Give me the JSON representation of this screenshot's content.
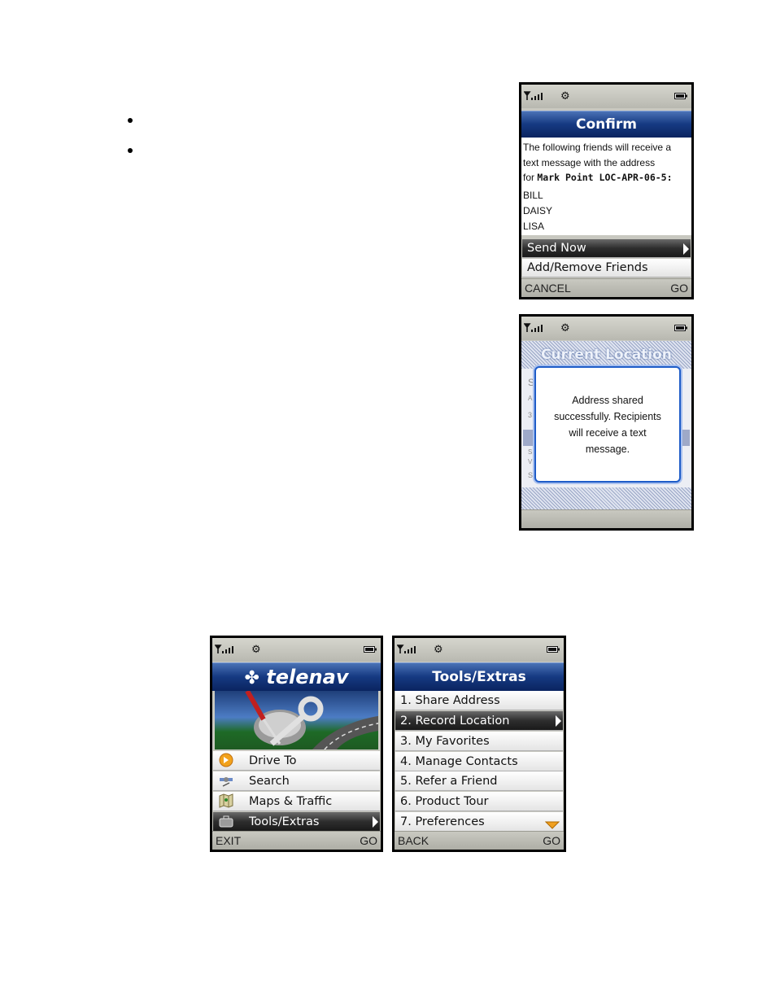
{
  "phone_confirm": {
    "title": "Confirm",
    "message_lines": [
      "The following friends will receive a",
      "text message with the address"
    ],
    "for_prefix": "for",
    "address_name": "Mark Point LOC-APR-06-5:",
    "recipients": [
      "BILL",
      "DAISY",
      "LISA"
    ],
    "options": [
      "Send Now",
      "Add/Remove Friends"
    ],
    "softkey_left": "CANCEL",
    "softkey_right": "GO"
  },
  "phone_current_location": {
    "title": "Current Location",
    "dialog_lines": [
      "Address shared",
      "successfully.  Recipients",
      "will receive a text",
      "message."
    ],
    "underlay_letters": [
      "S",
      "A",
      "3",
      "S",
      "V",
      "S"
    ]
  },
  "phone_home": {
    "brand": "telenav",
    "items": [
      {
        "label": "Drive To",
        "icon": "drive-to-icon"
      },
      {
        "label": "Search",
        "icon": "search-satellite-icon"
      },
      {
        "label": "Maps & Traffic",
        "icon": "map-icon"
      },
      {
        "label": "Tools/Extras",
        "icon": "toolbox-icon"
      }
    ],
    "softkey_left": "EXIT",
    "softkey_right": "GO"
  },
  "phone_tools": {
    "title": "Tools/Extras",
    "items": [
      "1. Share Address",
      "2. Record Location",
      "3. My Favorites",
      "4. Manage Contacts",
      "5. Refer a Friend",
      "6. Product Tour",
      "7. Preferences"
    ],
    "softkey_left": "BACK",
    "softkey_right": "GO"
  },
  "colors": {
    "title_blue": "#163a82",
    "selection_dark": "#2e2e2e",
    "dialog_border": "#1e5cc8",
    "scroll_arrow": "#f0a020"
  }
}
